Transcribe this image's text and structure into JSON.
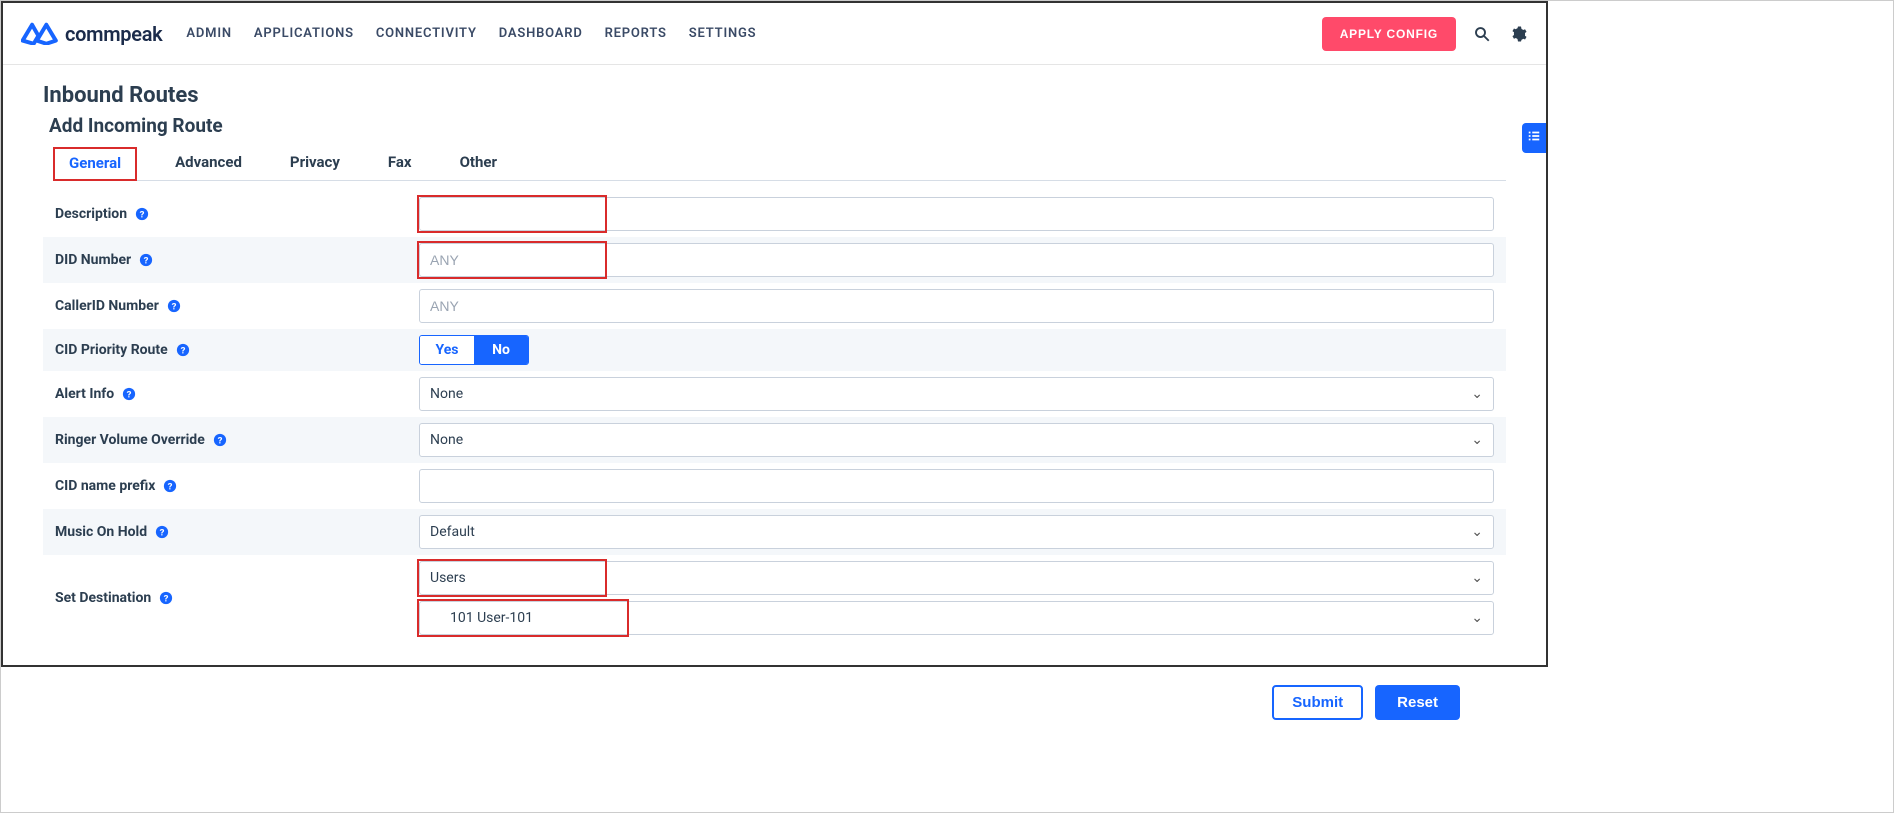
{
  "brand": {
    "name": "commpeak"
  },
  "nav": [
    "ADMIN",
    "APPLICATIONS",
    "CONNECTIVITY",
    "DASHBOARD",
    "REPORTS",
    "SETTINGS"
  ],
  "header": {
    "apply_config": "APPLY CONFIG"
  },
  "page": {
    "title": "Inbound Routes",
    "subtitle": "Add Incoming Route"
  },
  "tabs": [
    "General",
    "Advanced",
    "Privacy",
    "Fax",
    "Other"
  ],
  "active_tab": 0,
  "form": {
    "description": {
      "label": "Description",
      "value": ""
    },
    "did_number": {
      "label": "DID Number",
      "placeholder": "ANY",
      "value": ""
    },
    "callerid_number": {
      "label": "CallerID Number",
      "placeholder": "ANY",
      "value": ""
    },
    "cid_priority": {
      "label": "CID Priority Route",
      "yes": "Yes",
      "no": "No",
      "value": "No"
    },
    "alert_info": {
      "label": "Alert Info",
      "value": "None"
    },
    "ringer_volume": {
      "label": "Ringer Volume Override",
      "value": "None"
    },
    "cid_name_prefix": {
      "label": "CID name prefix",
      "value": ""
    },
    "music_on_hold": {
      "label": "Music On Hold",
      "value": "Default"
    },
    "set_destination": {
      "label": "Set Destination",
      "type": "Users",
      "target": "101 User-101"
    }
  },
  "buttons": {
    "submit": "Submit",
    "reset": "Reset"
  },
  "colors": {
    "accent": "#1765ff",
    "danger_highlight": "#d92b2b",
    "apply": "#ff4a6a"
  }
}
